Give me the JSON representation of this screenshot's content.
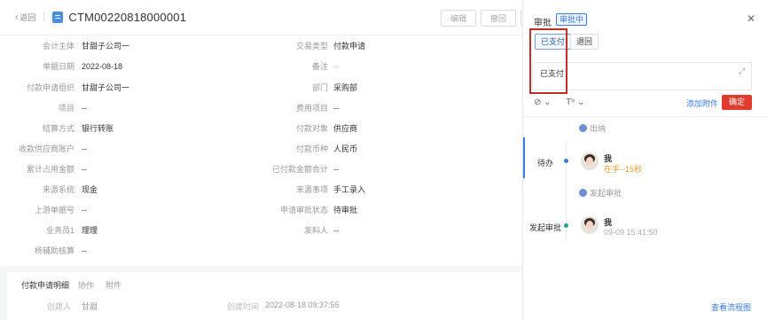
{
  "header": {
    "back_label": "返回",
    "doc_no": "CTM00220818000001",
    "buttons": [
      "编辑",
      "撤回"
    ]
  },
  "form": {
    "left": [
      {
        "label": "会计主体",
        "value": "甘甜子公司一"
      },
      {
        "label": "单据日期",
        "value": "2022-08-18"
      },
      {
        "label": "付款申请组织",
        "value": "甘甜子公司一"
      },
      {
        "label": "项目",
        "value": "--"
      },
      {
        "label": "结算方式",
        "value": "银行转账"
      },
      {
        "label": "收款供应商账户",
        "value": "--"
      },
      {
        "label": "累计占用金额",
        "value": "--"
      },
      {
        "label": "来源系统",
        "value": "现金"
      },
      {
        "label": "上游单据号",
        "value": "--"
      },
      {
        "label": "业务员1",
        "value": "理理"
      },
      {
        "label": "杨辅助核算",
        "value": "--"
      }
    ],
    "right": [
      {
        "label": "交易类型",
        "value": "付款申请"
      },
      {
        "label": "备注",
        "value": "--"
      },
      {
        "label": "部门",
        "value": "采购部"
      },
      {
        "label": "费用项目",
        "value": "--"
      },
      {
        "label": "付款对象",
        "value": "供应商"
      },
      {
        "label": "付款币种",
        "value": "人民币"
      },
      {
        "label": "已付款金额合计",
        "value": "--"
      },
      {
        "label": "来源事项",
        "value": "手工录入"
      },
      {
        "label": "申请审批状态",
        "value": "待审批"
      },
      {
        "label": "发料人",
        "value": "--"
      }
    ]
  },
  "bottom": {
    "tabs": [
      "付款申请明细",
      "协作",
      "附件"
    ],
    "creator_label": "创建人",
    "creator_value": "甘甜",
    "created_time_label": "创建时间",
    "created_time_value": "2022-08-18 09:37:55"
  },
  "panel": {
    "title": "审批",
    "status_badge": "审批中",
    "options": [
      "已支付",
      "退回"
    ],
    "comment_text": "已支付",
    "tool_icons": [
      "⊘ ⌄",
      "Tᵒ ⌄"
    ],
    "add_attachment": "添加附件",
    "confirm": "确定",
    "timeline": {
      "node_top": "出纳",
      "pending_label": "待办",
      "pending_person": "我",
      "pending_sub": "在手--15秒",
      "node_mid": "发起审批",
      "start_label": "发起审批",
      "start_person": "我",
      "start_time": "09-09 15:41:50"
    },
    "view_flow": "查看流程图"
  },
  "colors": {
    "accent": "#3a7be0",
    "confirm_red": "#e23b2e",
    "highlight_red": "#c0302b",
    "orange": "#e69a2a",
    "start_green": "#1aaa8a"
  }
}
